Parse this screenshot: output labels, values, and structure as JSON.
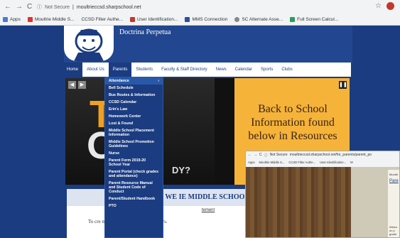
{
  "browser": {
    "nav": [
      "←",
      "→",
      "C"
    ],
    "security": "Not Secure",
    "url": "moultrieccsd.sharpschool.net",
    "bookmarks": [
      "Apps",
      "Moultrie Middle S...",
      "CCSD Filter Authe...",
      "User Identification...",
      "MMS Connection",
      "SC Alternate Asse...",
      "Full Screen Calcul..."
    ]
  },
  "site": {
    "title": "Doctrina Perpetua",
    "nav": [
      "Home",
      "About Us",
      "Parents",
      "Students",
      "Faculty & Staff Directory",
      "News",
      "Calendar",
      "Sports",
      "Clubs"
    ],
    "hero": {
      "big1": "TO",
      "big2": "OL",
      "tail": "DY?",
      "right_text": "Back to School Information found below in Resources"
    },
    "banner": "WE  IE MIDDLE SCHOOL.",
    "content_line1": "tement",
    "content_line2": "To cre            mmunity of responsible learners."
  },
  "dropdown": {
    "items": [
      "Attendance",
      "Bell Schedule",
      "Bus Routes & Information",
      "CCSD Calendar",
      "Erin's Law",
      "Homework Center",
      "Lost & Found",
      "Middle School Placement Information",
      "Middle School Promotion Guidelines",
      "Nurse",
      "Parent Form 2019-20 School Year",
      "Parent Portal (check grades and attendance)",
      "Parent Resource Manual and Student Code of Conduct",
      "Parent/Student Handbook",
      "PTO"
    ]
  },
  "overlay": {
    "security": "Not Secure",
    "url": "moultrieccsd.sharpschool.net/for_parents/parent_po",
    "bookmarks": [
      "Apps",
      "Moultrie Middle S...",
      "CCSD Filter Authe...",
      "User Identification...",
      "M"
    ],
    "paper_title": "Moultri",
    "paper_heading": "Pare",
    "paper_text": "Welco on y grade"
  }
}
